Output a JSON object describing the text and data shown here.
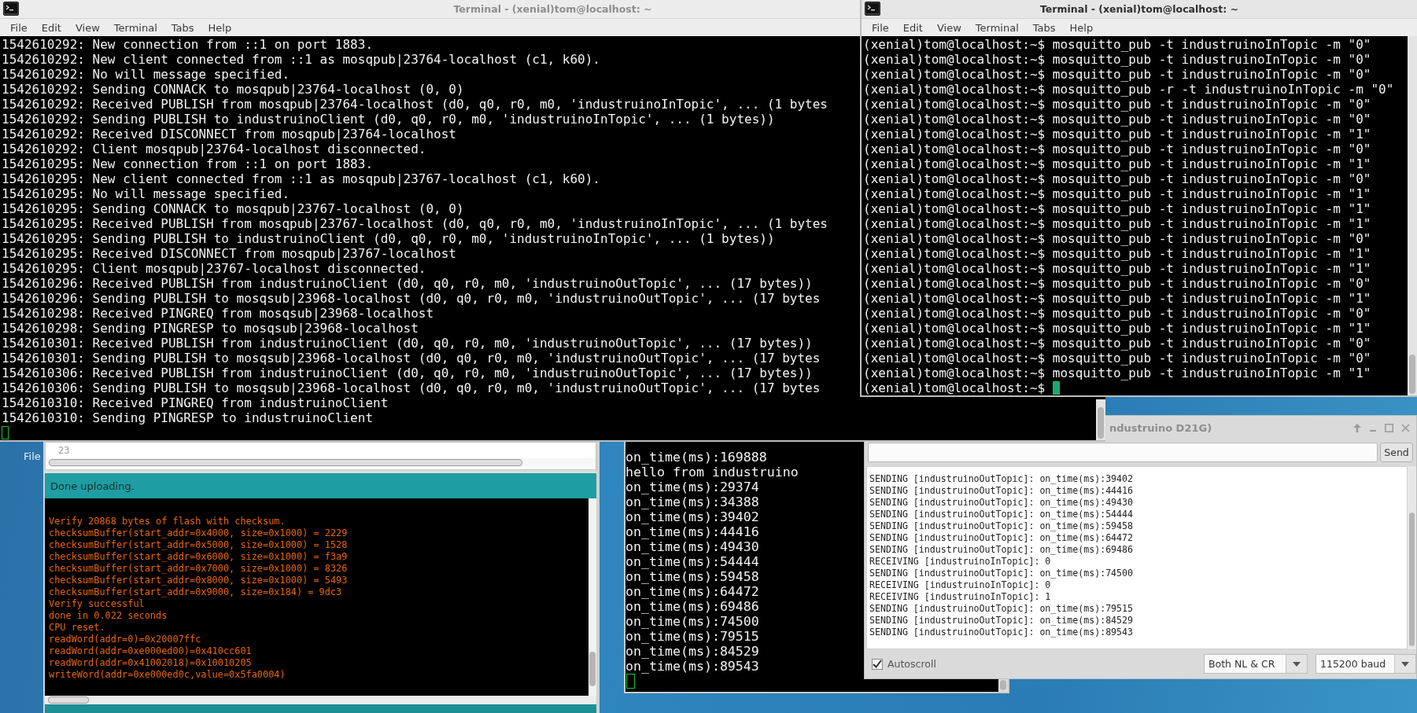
{
  "desktop_menu": {
    "label": "File"
  },
  "log_terminal": {
    "title": "Terminal - (xenial)tom@localhost: ~",
    "active": false,
    "menu": [
      "File",
      "Edit",
      "View",
      "Terminal",
      "Tabs",
      "Help"
    ],
    "lines": [
      "1542610292: New connection from ::1 on port 1883.",
      "1542610292: New client connected from ::1 as mosqpub|23764-localhost (c1, k60).",
      "1542610292: No will message specified.",
      "1542610292: Sending CONNACK to mosqpub|23764-localhost (0, 0)",
      "1542610292: Received PUBLISH from mosqpub|23764-localhost (d0, q0, r0, m0, 'industruinoInTopic', ... (1 bytes",
      "1542610292: Sending PUBLISH to industruinoClient (d0, q0, r0, m0, 'industruinoInTopic', ... (1 bytes))",
      "1542610292: Received DISCONNECT from mosqpub|23764-localhost",
      "1542610292: Client mosqpub|23764-localhost disconnected.",
      "1542610295: New connection from ::1 on port 1883.",
      "1542610295: New client connected from ::1 as mosqpub|23767-localhost (c1, k60).",
      "1542610295: No will message specified.",
      "1542610295: Sending CONNACK to mosqpub|23767-localhost (0, 0)",
      "1542610295: Received PUBLISH from mosqpub|23767-localhost (d0, q0, r0, m0, 'industruinoInTopic', ... (1 bytes",
      "1542610295: Sending PUBLISH to industruinoClient (d0, q0, r0, m0, 'industruinoInTopic', ... (1 bytes))",
      "1542610295: Received DISCONNECT from mosqpub|23767-localhost",
      "1542610295: Client mosqpub|23767-localhost disconnected.",
      "1542610296: Received PUBLISH from industruinoClient (d0, q0, r0, m0, 'industruinoOutTopic', ... (17 bytes))",
      "1542610296: Sending PUBLISH to mosqsub|23968-localhost (d0, q0, r0, m0, 'industruinoOutTopic', ... (17 bytes",
      "1542610298: Received PINGREQ from mosqsub|23968-localhost",
      "1542610298: Sending PINGRESP to mosqsub|23968-localhost",
      "1542610301: Received PUBLISH from industruinoClient (d0, q0, r0, m0, 'industruinoOutTopic', ... (17 bytes))",
      "1542610301: Sending PUBLISH to mosqsub|23968-localhost (d0, q0, r0, m0, 'industruinoOutTopic', ... (17 bytes",
      "1542610306: Received PUBLISH from industruinoClient (d0, q0, r0, m0, 'industruinoOutTopic', ... (17 bytes))",
      "1542610306: Sending PUBLISH to mosqsub|23968-localhost (d0, q0, r0, m0, 'industruinoOutTopic', ... (17 bytes",
      "1542610310: Received PINGREQ from industruinoClient",
      "1542610310: Sending PINGRESP to industruinoClient"
    ]
  },
  "publish_terminal": {
    "title": "Terminal - (xenial)tom@localhost: ~",
    "active": true,
    "menu": [
      "File",
      "Edit",
      "View",
      "Terminal",
      "Tabs",
      "Help"
    ],
    "lines": [
      "(xenial)tom@localhost:~$ mosquitto_pub -t industruinoInTopic -m \"0\"",
      "(xenial)tom@localhost:~$ mosquitto_pub -t industruinoInTopic -m \"0\"",
      "(xenial)tom@localhost:~$ mosquitto_pub -t industruinoInTopic -m \"0\"",
      "(xenial)tom@localhost:~$ mosquitto_pub -r -t industruinoInTopic -m \"0\"",
      "(xenial)tom@localhost:~$ mosquitto_pub -t industruinoInTopic -m \"0\"",
      "(xenial)tom@localhost:~$ mosquitto_pub -t industruinoInTopic -m \"0\"",
      "(xenial)tom@localhost:~$ mosquitto_pub -t industruinoInTopic -m \"1\"",
      "(xenial)tom@localhost:~$ mosquitto_pub -t industruinoInTopic -m \"0\"",
      "(xenial)tom@localhost:~$ mosquitto_pub -t industruinoInTopic -m \"1\"",
      "(xenial)tom@localhost:~$ mosquitto_pub -t industruinoInTopic -m \"0\"",
      "(xenial)tom@localhost:~$ mosquitto_pub -t industruinoInTopic -m \"1\"",
      "(xenial)tom@localhost:~$ mosquitto_pub -t industruinoInTopic -m \"1\"",
      "(xenial)tom@localhost:~$ mosquitto_pub -t industruinoInTopic -m \"1\"",
      "(xenial)tom@localhost:~$ mosquitto_pub -t industruinoInTopic -m \"0\"",
      "(xenial)tom@localhost:~$ mosquitto_pub -t industruinoInTopic -m \"1\"",
      "(xenial)tom@localhost:~$ mosquitto_pub -t industruinoInTopic -m \"1\"",
      "(xenial)tom@localhost:~$ mosquitto_pub -t industruinoInTopic -m \"0\"",
      "(xenial)tom@localhost:~$ mosquitto_pub -t industruinoInTopic -m \"1\"",
      "(xenial)tom@localhost:~$ mosquitto_pub -t industruinoInTopic -m \"0\"",
      "(xenial)tom@localhost:~$ mosquitto_pub -t industruinoInTopic -m \"1\"",
      "(xenial)tom@localhost:~$ mosquitto_pub -t industruinoInTopic -m \"0\"",
      "(xenial)tom@localhost:~$ mosquitto_pub -t industruinoInTopic -m \"0\"",
      "(xenial)tom@localhost:~$ mosquitto_pub -t industruinoInTopic -m \"1\"",
      "(xenial)tom@localhost:~$"
    ]
  },
  "arduino_ide": {
    "line_numbers": [
      "23"
    ],
    "status": "Done uploading.",
    "console_lines": [
      "Verify 20868 bytes of flash with checksum.",
      "checksumBuffer(start_addr=0x4000, size=0x1000) = 2229",
      "checksumBuffer(start_addr=0x5000, size=0x1000) = 1528",
      "checksumBuffer(start_addr=0x6000, size=0x1000) = f3a9",
      "checksumBuffer(start_addr=0x7000, size=0x1000) = 8326",
      "checksumBuffer(start_addr=0x8000, size=0x1000) = 5493",
      "checksumBuffer(start_addr=0x9000, size=0x184) = 9dc3",
      "Verify successful",
      "done in 0.022 seconds",
      "CPU reset.",
      "readWord(addr=0)=0x20007ffc",
      "readWord(addr=0xe000ed00)=0x410cc601",
      "readWord(addr=0x41002018)=0x10010205",
      "writeWord(addr=0xe000ed0c,value=0x5fa0004)"
    ]
  },
  "serial_terminal": {
    "active": false,
    "lines": [
      "on_time(ms):169888",
      "hello from industruino",
      "on_time(ms):29374",
      "on_time(ms):34388",
      "on_time(ms):39402",
      "on_time(ms):44416",
      "on_time(ms):49430",
      "on_time(ms):54444",
      "on_time(ms):59458",
      "on_time(ms):64472",
      "on_time(ms):69486",
      "on_time(ms):74500",
      "on_time(ms):79515",
      "on_time(ms):84529",
      "on_time(ms):89543"
    ]
  },
  "serial_monitor": {
    "title": "ndustruino D21G)",
    "send_button": "Send",
    "lines": [
      "SENDING [industruinoOutTopic]: on_time(ms):39402",
      "SENDING [industruinoOutTopic]: on_time(ms):44416",
      "SENDING [industruinoOutTopic]: on_time(ms):49430",
      "SENDING [industruinoOutTopic]: on_time(ms):54444",
      "SENDING [industruinoOutTopic]: on_time(ms):59458",
      "SENDING [industruinoOutTopic]: on_time(ms):64472",
      "SENDING [industruinoOutTopic]: on_time(ms):69486",
      "RECEIVING [industruinoInTopic]: 0",
      "SENDING [industruinoOutTopic]: on_time(ms):74500",
      "RECEIVING [industruinoInTopic]: 0",
      "RECEIVING [industruinoInTopic]: 1",
      "SENDING [industruinoOutTopic]: on_time(ms):79515",
      "SENDING [industruinoOutTopic]: on_time(ms):84529",
      "SENDING [industruinoOutTopic]: on_time(ms):89543"
    ],
    "autoscroll": {
      "label": "Autoscroll",
      "checked": true
    },
    "line_ending": "Both NL & CR",
    "baud_rate": "115200 baud"
  }
}
